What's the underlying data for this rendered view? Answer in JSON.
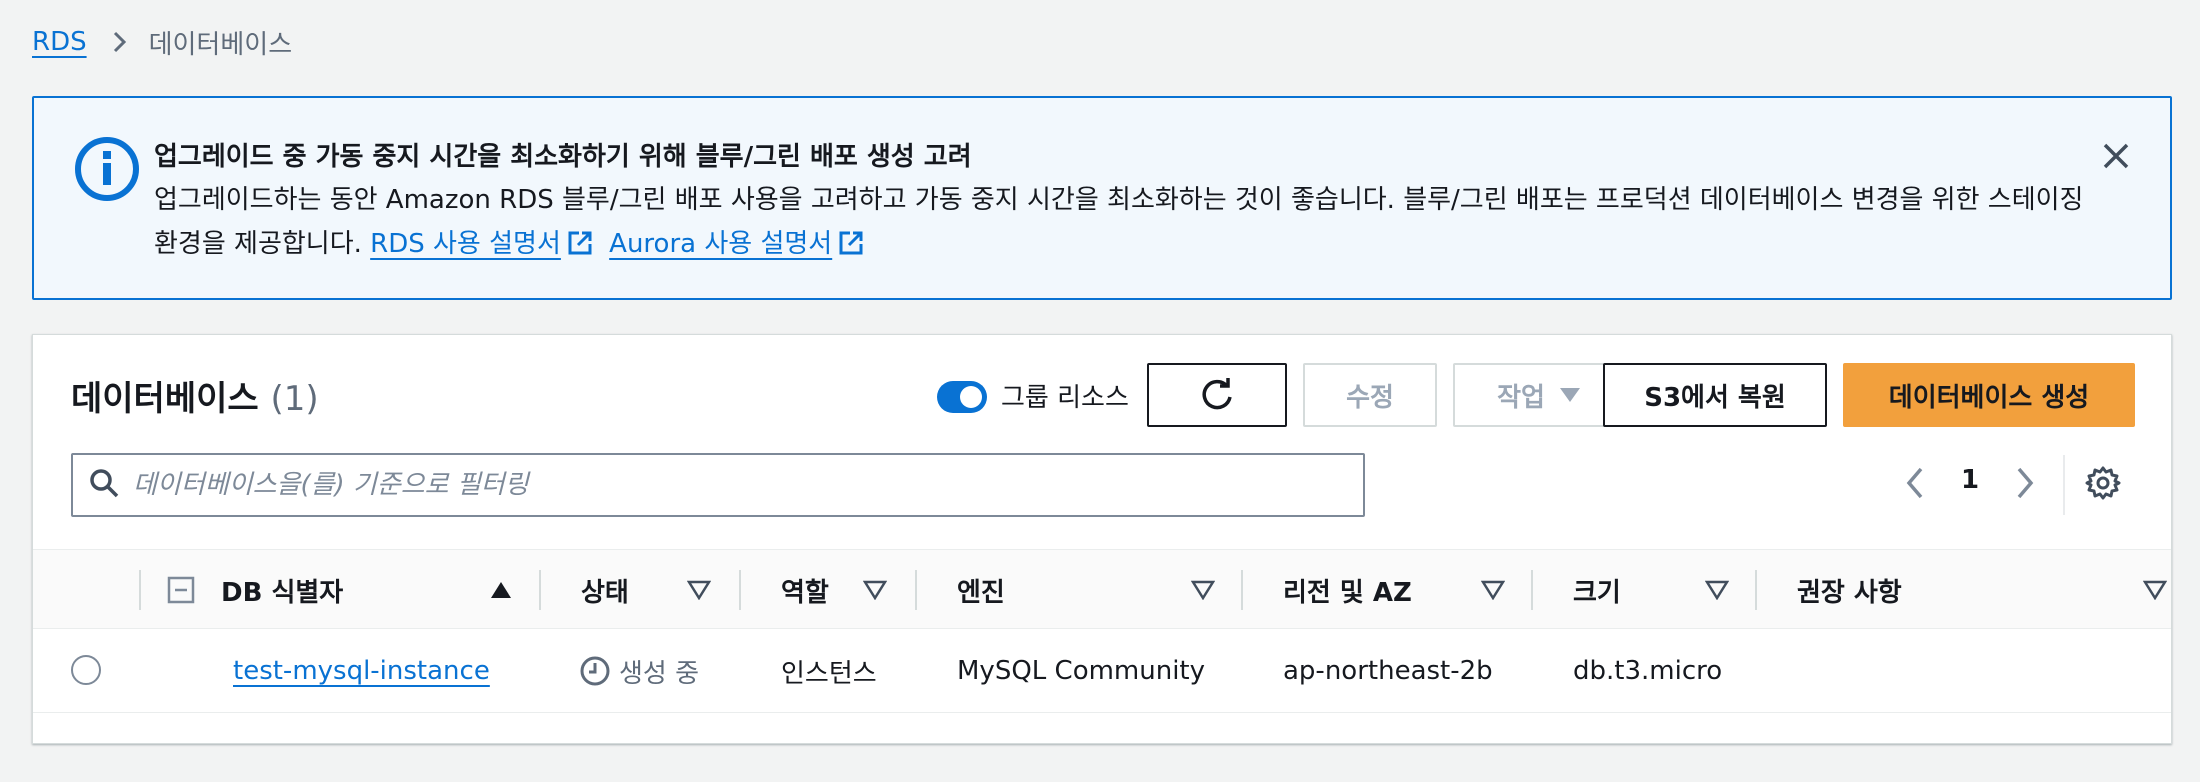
{
  "breadcrumb": {
    "root": "RDS",
    "current": "데이터베이스"
  },
  "banner": {
    "title": "업그레이드 중 가동 중지 시간을 최소화하기 위해 블루/그린 배포 생성 고려",
    "body": "업그레이드하는 동안 Amazon RDS 블루/그린 배포 사용을 고려하고 가동 중지 시간을 최소화하는 것이 좋습니다. 블루/그린 배포는 프로덕션 데이터베이스 변경을 위한 스테이징 환경을 제공합니다.",
    "link1": "RDS 사용 설명서",
    "link2": "Aurora 사용 설명서",
    "icons": {
      "info": "info-icon",
      "close": "close-icon",
      "external": "external-link-icon"
    }
  },
  "panel": {
    "title": "데이터베이스",
    "count": "(1)",
    "group_toggle_label": "그룹 리소스",
    "modify_label": "수정",
    "actions_label": "작업",
    "restore_label": "S3에서 복원",
    "create_label": "데이터베이스 생성",
    "search_placeholder": "데이터베이스을(를) 기준으로 필터링",
    "page": "1"
  },
  "table": {
    "columns": {
      "id": "DB 식별자",
      "status": "상태",
      "role": "역할",
      "engine": "엔진",
      "region": "리전 및 AZ",
      "size": "크기",
      "recommendation": "권장 사항"
    },
    "rows": [
      {
        "id": "test-mysql-instance",
        "status": "생성 중",
        "role": "인스턴스",
        "engine": "MySQL Community",
        "region": "ap-northeast-2b",
        "size": "db.t3.micro",
        "recommendation": ""
      }
    ]
  },
  "colors": {
    "link": "#0972d3",
    "banner_bg": "#f2f8fd",
    "primary_button": "#f2a03d",
    "toggle_on": "#0972d3"
  }
}
